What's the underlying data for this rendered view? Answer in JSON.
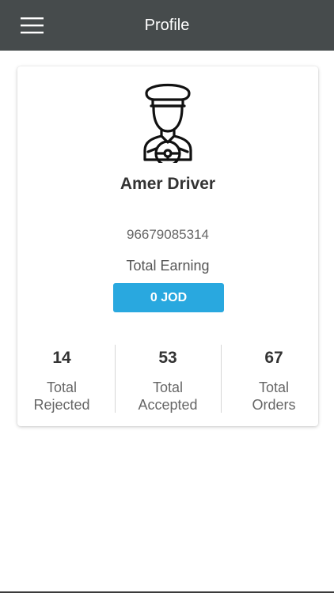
{
  "header": {
    "title": "Profile",
    "menu_icon": "hamburger-menu-icon",
    "background_color": "#464b4c"
  },
  "profile": {
    "avatar_icon": "driver-avatar-icon",
    "name": "Amer Driver",
    "phone": "96679085314",
    "earning_label": "Total Earning",
    "earning_value": "0 JOD",
    "earning_color": "#29a8df"
  },
  "stats": [
    {
      "value": "14",
      "label_line1": "Total",
      "label_line2": "Rejected"
    },
    {
      "value": "53",
      "label_line1": "Total",
      "label_line2": "Accepted"
    },
    {
      "value": "67",
      "label_line1": "Total",
      "label_line2": "Orders"
    }
  ]
}
